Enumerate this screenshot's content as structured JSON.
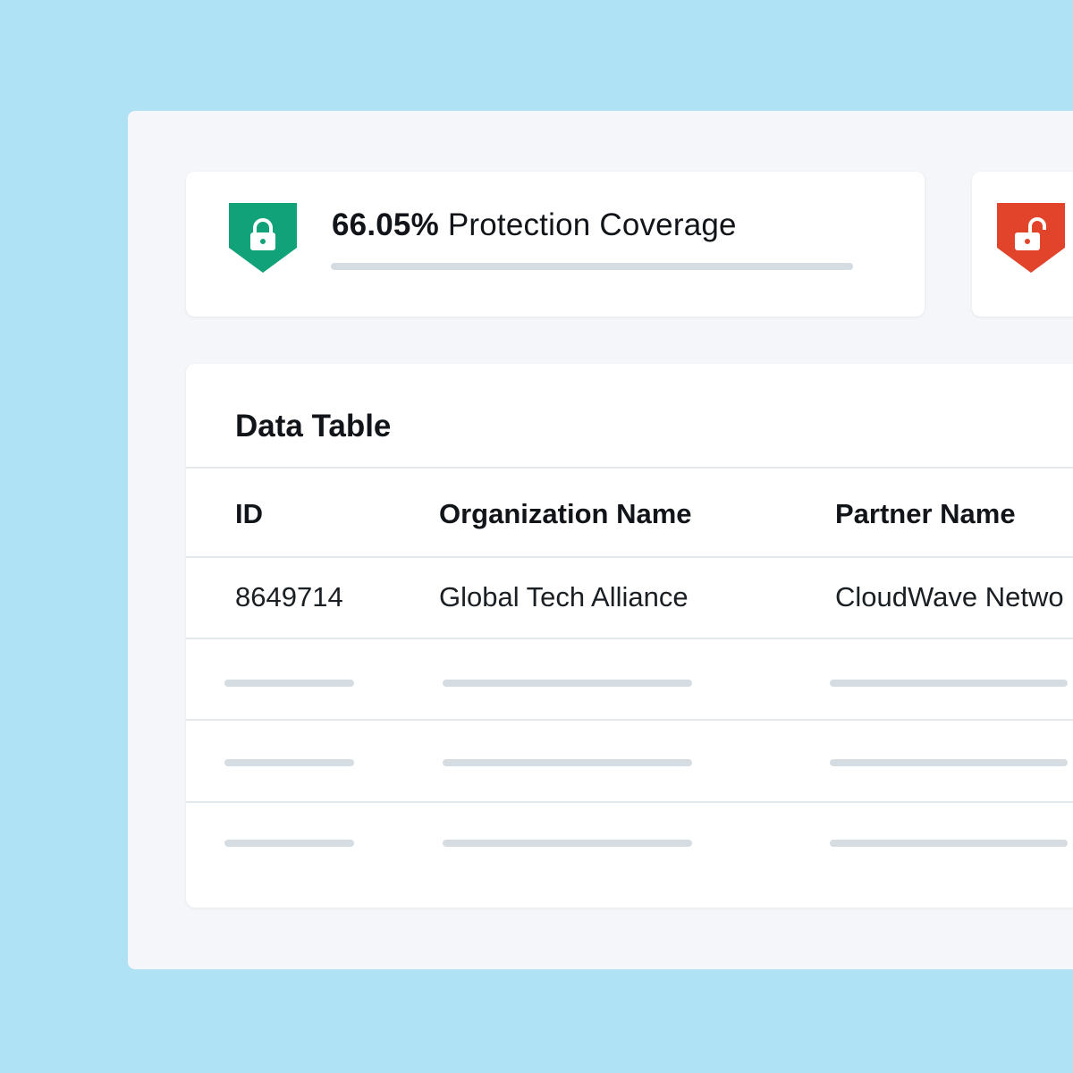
{
  "coverage": {
    "percent_label": "66.05%",
    "label": " Protection Coverage",
    "progress_fraction": 0,
    "status": "locked",
    "shield_color": "#12a27a"
  },
  "risk": {
    "status": "unlocked",
    "shield_color": "#e2432b"
  },
  "table": {
    "title": "Data Table",
    "columns": [
      "ID",
      "Organization Name",
      "Partner Name"
    ],
    "rows": [
      {
        "id": "8649714",
        "organization": "Global Tech Alliance",
        "partner": "CloudWave Netwo"
      }
    ],
    "placeholder_rows": 3
  },
  "colors": {
    "background": "#b0e2f5",
    "panel": "#f4f6f9",
    "skeleton": "#d5dde2"
  }
}
